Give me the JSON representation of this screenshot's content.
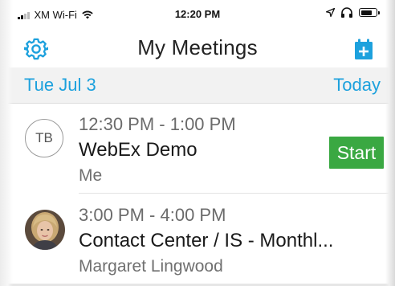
{
  "status_bar": {
    "carrier": "XM Wi-Fi",
    "time": "12:20 PM"
  },
  "nav": {
    "title": "My Meetings",
    "settings_icon": "gear-icon",
    "calendar_icon": "calendar-add-icon",
    "accent_color": "#1da1dd"
  },
  "date_header": {
    "date": "Tue Jul 3",
    "today_label": "Today"
  },
  "meetings": [
    {
      "avatar_initials": "TB",
      "time": "12:30 PM - 1:00 PM",
      "title": "WebEx Demo",
      "host": "Me",
      "action_label": "Start",
      "action_color": "#3aa842"
    },
    {
      "time": "3:00 PM - 4:00 PM",
      "title": "Contact Center / IS - Monthl...",
      "host": "Margaret Lingwood"
    }
  ]
}
